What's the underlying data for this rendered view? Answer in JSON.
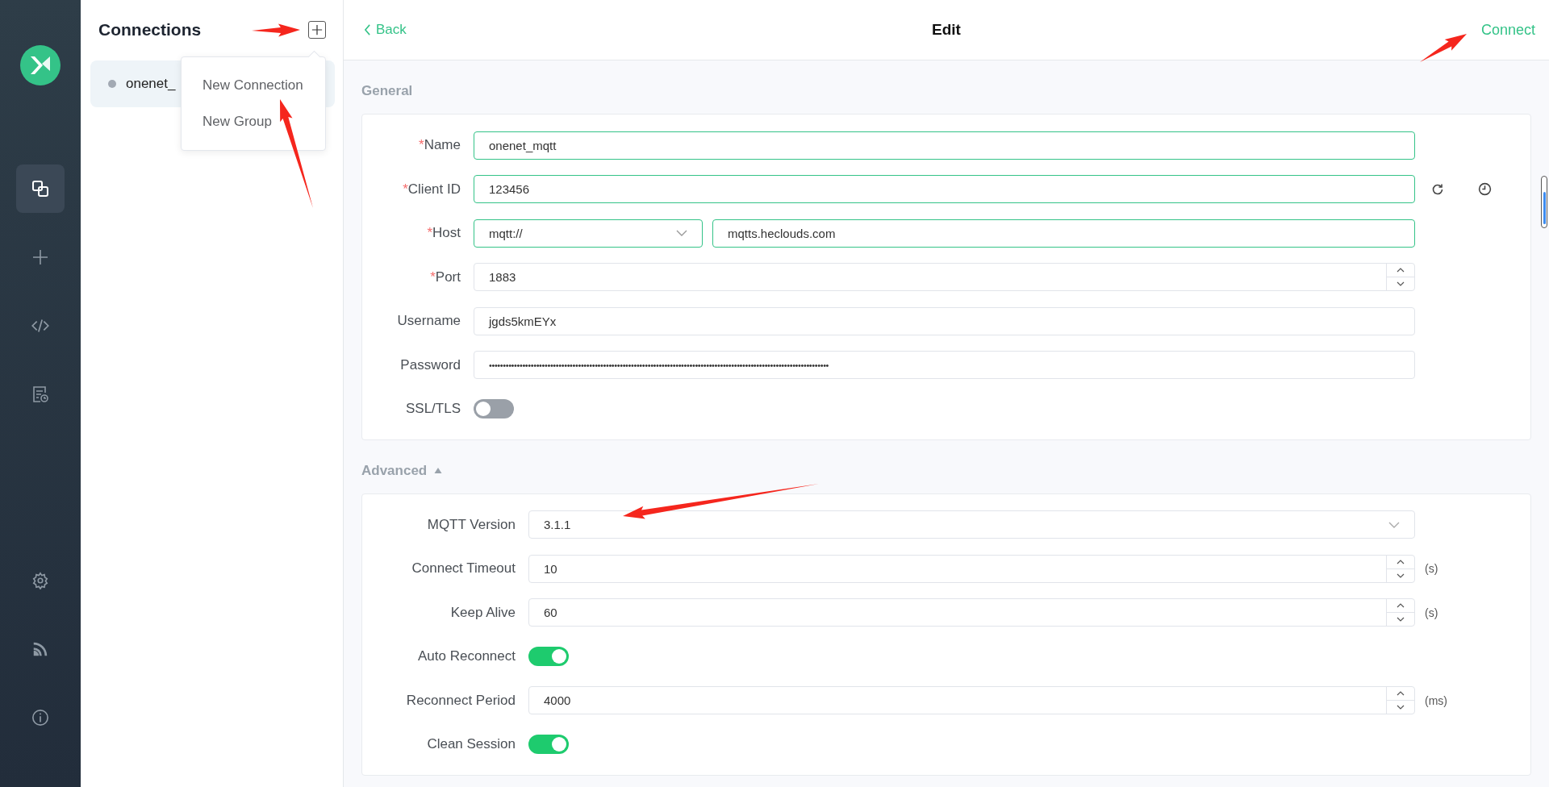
{
  "nav": [
    {
      "kind": "connections",
      "selected": true
    },
    {
      "kind": "new",
      "selected": false
    },
    {
      "kind": "script",
      "selected": false
    },
    {
      "kind": "log",
      "selected": false
    }
  ],
  "nav_bottom": [
    {
      "kind": "settings"
    },
    {
      "kind": "feed"
    },
    {
      "kind": "about"
    }
  ],
  "connections": {
    "title": "Connections",
    "items": [
      {
        "name": "onenet_",
        "selected": true
      }
    ]
  },
  "menu": [
    "New Connection",
    "New Group"
  ],
  "header": {
    "back": "Back",
    "title": "Edit",
    "action": "Connect"
  },
  "sections": [
    {
      "title": "General",
      "fields": [
        {
          "label": "Name",
          "mark": "*",
          "kind": "text",
          "value": "onenet_mqtt",
          "valid": true
        },
        {
          "label": "Client ID",
          "mark": "*",
          "kind": "client-id",
          "value": "123456",
          "valid": true
        },
        {
          "label": "Host",
          "mark": "*",
          "kind": "host",
          "protocol": "mqtt://",
          "value": "mqtts.heclouds.com",
          "valid": true
        },
        {
          "label": "Port",
          "mark": "*",
          "kind": "number",
          "value": "1883",
          "valid": false
        },
        {
          "label": "Username",
          "kind": "text",
          "value": "jgds5kmEYx",
          "valid": false
        },
        {
          "label": "Password",
          "kind": "password",
          "value": "••••••••••••••••••••••••••••••••••••••••••••••••••••••••••••••••••••••••••••••••••••••••••••••••••••••••••••••••••••••••••",
          "valid": false
        },
        {
          "label": "SSL/TLS",
          "kind": "switch",
          "on": false
        }
      ]
    },
    {
      "title": "Advanced",
      "expanded": true,
      "fields": [
        {
          "label": "MQTT Version",
          "kind": "select",
          "value": "3.1.1",
          "valid": false
        },
        {
          "label": "Connect Timeout",
          "kind": "number",
          "value": "10",
          "unit": "(s)",
          "valid": false
        },
        {
          "label": "Keep Alive",
          "kind": "number",
          "value": "60",
          "unit": "(s)",
          "valid": false
        },
        {
          "label": "Auto Reconnect",
          "kind": "switch",
          "on": true
        },
        {
          "label": "Reconnect Period",
          "kind": "number",
          "value": "4000",
          "unit": "(ms)",
          "valid": false
        },
        {
          "label": "Clean Session",
          "kind": "switch",
          "on": true
        }
      ]
    }
  ]
}
